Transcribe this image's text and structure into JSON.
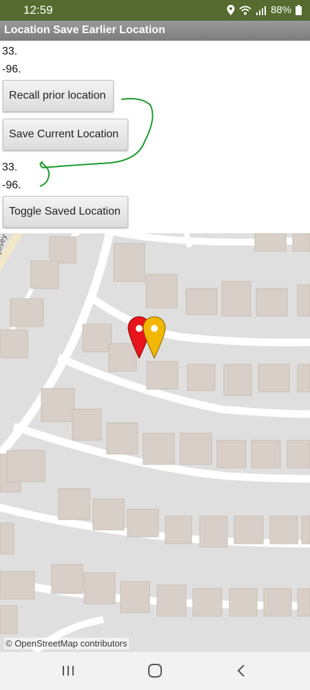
{
  "status_bar": {
    "time": "12:59",
    "battery": "88%"
  },
  "app": {
    "title": "Location Save Earlier Location"
  },
  "location_current": {
    "lat": "33.",
    "lon": "-96."
  },
  "location_saved": {
    "lat": "33.",
    "lon": "-96."
  },
  "buttons": {
    "recall": "Recall prior location",
    "save": "Save Current  Location",
    "toggle": "Toggle Saved Location"
  },
  "map": {
    "attribution": "© OpenStreetMap contributors",
    "street_label": "Josey"
  },
  "colors": {
    "status_bar": "#556b2f",
    "marker_red": "#e8141c",
    "marker_yellow": "#f2b705",
    "annotation_green": "#1a9a2a"
  }
}
